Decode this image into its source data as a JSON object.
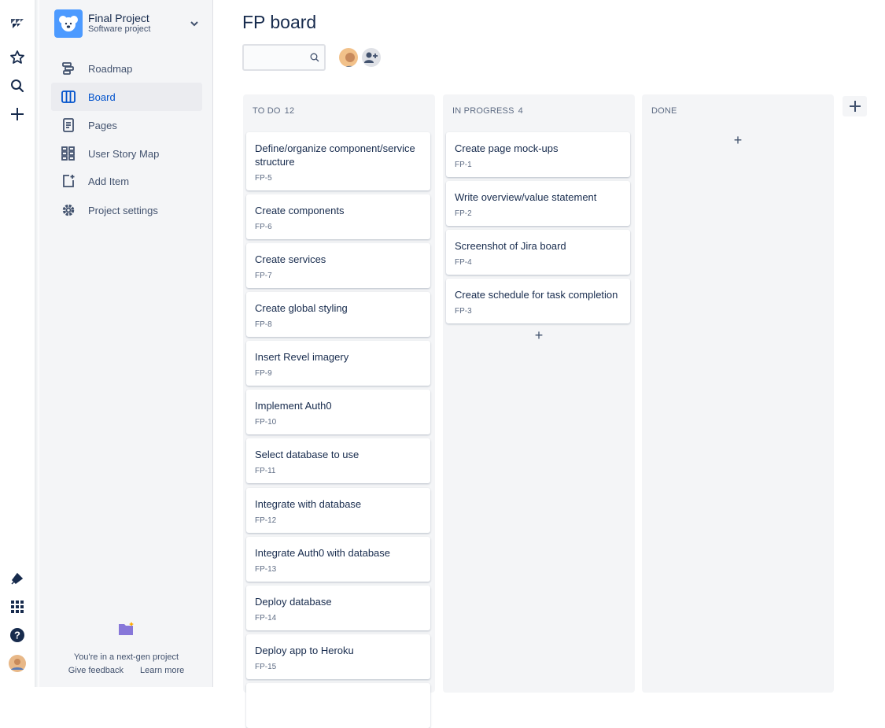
{
  "project": {
    "name": "Final Project",
    "type": "Software project"
  },
  "sidebar": {
    "items": [
      {
        "label": "Roadmap",
        "icon": "roadmap-icon"
      },
      {
        "label": "Board",
        "icon": "board-icon"
      },
      {
        "label": "Pages",
        "icon": "pages-icon"
      },
      {
        "label": "User Story Map",
        "icon": "story-map-icon"
      },
      {
        "label": "Add Item",
        "icon": "add-item-icon"
      },
      {
        "label": "Project settings",
        "icon": "gear-icon"
      }
    ],
    "active": "Board",
    "footer": {
      "message": "You're in a next-gen project",
      "feedback": "Give feedback",
      "learn": "Learn more"
    }
  },
  "board": {
    "title": "FP board",
    "search_placeholder": "",
    "columns": [
      {
        "title": "TO DO",
        "count": "12",
        "cards": [
          {
            "title": "Define/organize component/service structure",
            "key": "FP-5"
          },
          {
            "title": "Create components",
            "key": "FP-6"
          },
          {
            "title": "Create services",
            "key": "FP-7"
          },
          {
            "title": "Create global styling",
            "key": "FP-8"
          },
          {
            "title": "Insert Revel imagery",
            "key": "FP-9"
          },
          {
            "title": "Implement Auth0",
            "key": "FP-10"
          },
          {
            "title": "Select database to use",
            "key": "FP-11"
          },
          {
            "title": "Integrate with database",
            "key": "FP-12"
          },
          {
            "title": "Integrate Auth0 with database",
            "key": "FP-13"
          },
          {
            "title": "Deploy database",
            "key": "FP-14"
          },
          {
            "title": "Deploy app to Heroku",
            "key": "FP-15"
          }
        ]
      },
      {
        "title": "IN PROGRESS",
        "count": "4",
        "cards": [
          {
            "title": "Create page mock-ups",
            "key": "FP-1"
          },
          {
            "title": "Write overview/value statement",
            "key": "FP-2"
          },
          {
            "title": "Screenshot of Jira board",
            "key": "FP-4"
          },
          {
            "title": "Create schedule for task completion",
            "key": "FP-3"
          }
        ]
      },
      {
        "title": "DONE",
        "count": "",
        "cards": []
      }
    ]
  },
  "colors": {
    "accent": "#0052cc",
    "column_bg": "#f4f5f7",
    "sidebar_bg": "#f4f5f7",
    "text": "#172b4d",
    "subtle": "#5e6c84"
  }
}
